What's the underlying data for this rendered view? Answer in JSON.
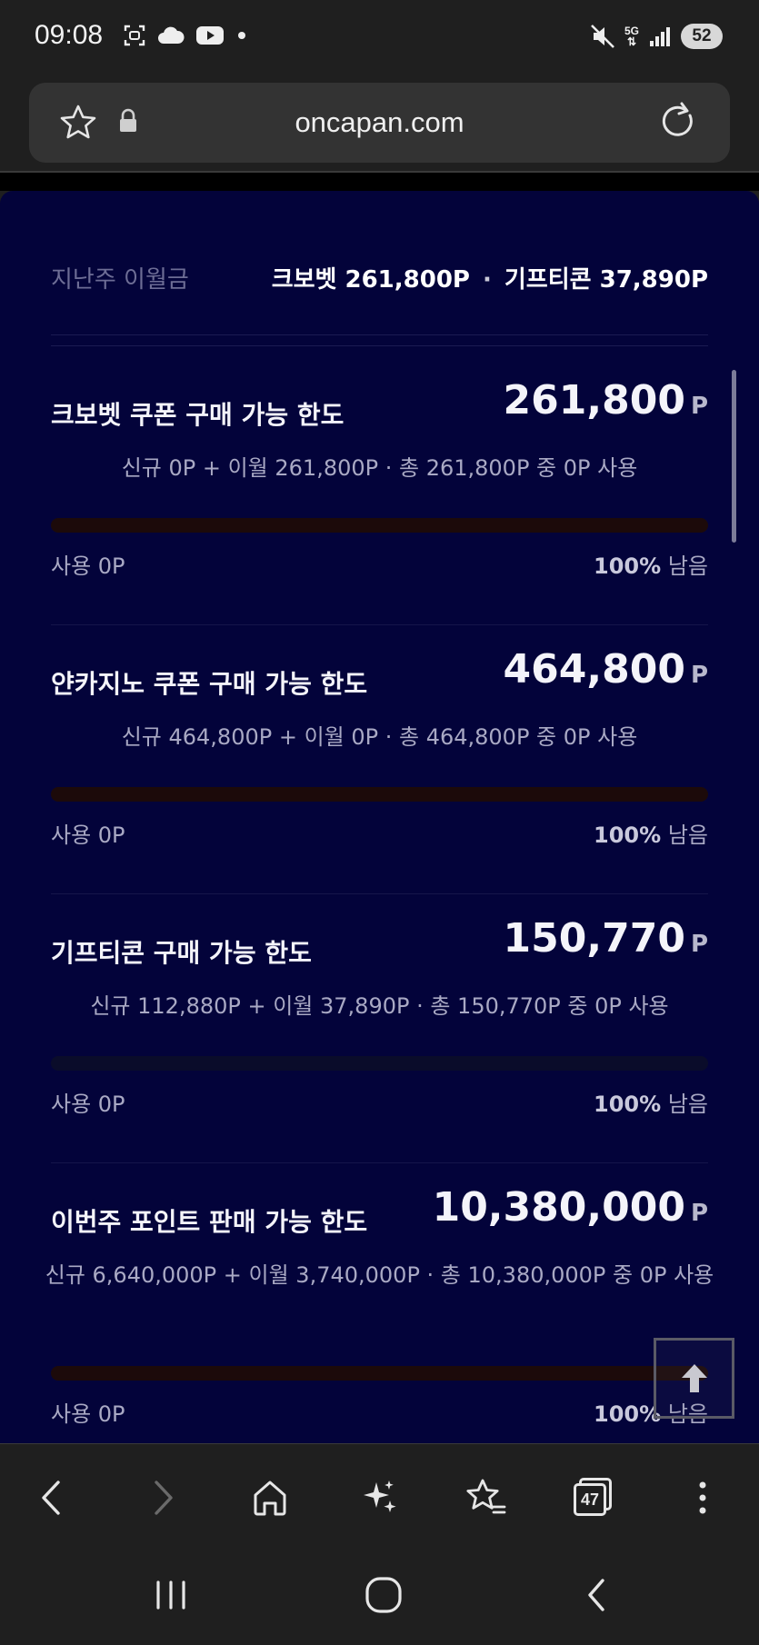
{
  "status_bar": {
    "time": "09:08",
    "battery": "52",
    "network": "5G",
    "icons": [
      "screenshot-icon",
      "cloud-icon",
      "youtube-icon",
      "notification-dot-icon",
      "mute-icon",
      "signal-icon",
      "battery-icon"
    ]
  },
  "browser": {
    "url": "oncapan.com",
    "tab_count": "47"
  },
  "summary": {
    "label": "지난주 이월금",
    "value1": "크보벳 261,800P",
    "separator": "·",
    "value2": "기프티콘 37,890P"
  },
  "cards": [
    {
      "title": "크보벳 쿠폰 구매 가능 한도",
      "amount": "261,800",
      "unit": "P",
      "detail": "신규 0P + 이월 261,800P · 총 261,800P 중 0P 사용",
      "used": "사용 0P",
      "remain_pct": "100%",
      "remain_label": "남음",
      "remaining_fraction": 1.0,
      "bar_color": "#1c0a0a"
    },
    {
      "title": "얀카지노 쿠폰 구매 가능 한도",
      "amount": "464,800",
      "unit": "P",
      "detail": "신규 464,800P + 이월 0P · 총 464,800P 중 0P 사용",
      "used": "사용 0P",
      "remain_pct": "100%",
      "remain_label": "남음",
      "remaining_fraction": 1.0,
      "bar_color": "#1c0a0a"
    },
    {
      "title": "기프티콘 구매 가능 한도",
      "amount": "150,770",
      "unit": "P",
      "detail": "신규 112,880P + 이월 37,890P · 총 150,770P 중 0P 사용",
      "used": "사용 0P",
      "remain_pct": "100%",
      "remain_label": "남음",
      "remaining_fraction": 1.0,
      "bar_color": "#0a0c2a"
    },
    {
      "title": "이번주 포인트 판매 가능 한도",
      "amount": "10,380,000",
      "unit": "P",
      "detail": "신규 6,640,000P + 이월 3,740,000P · 총 10,380,000P 중 0P 사용",
      "used": "사용 0P",
      "remain_pct": "100%",
      "remain_label": "남음",
      "remaining_fraction": 1.0,
      "bar_color": "#1c0a0a"
    }
  ]
}
